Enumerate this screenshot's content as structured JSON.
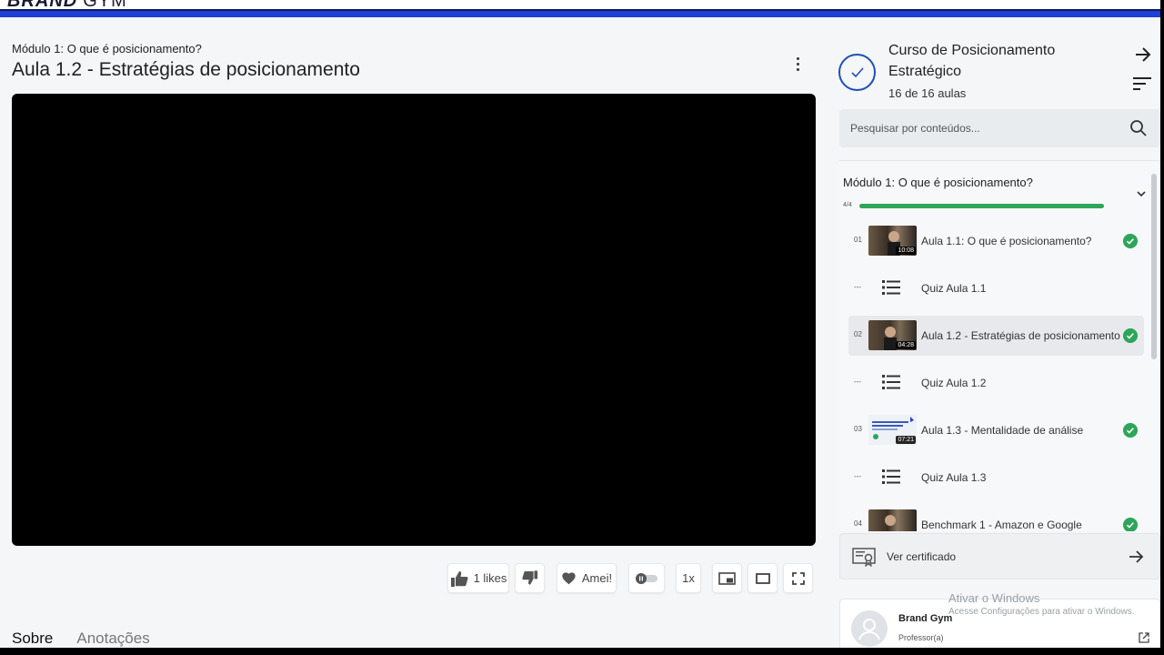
{
  "brand": {
    "bold": "BRAND",
    "light": "GYM"
  },
  "header": {
    "module_subtitle": "Módulo 1: O que é posicionamento?",
    "lesson_title": "Aula 1.2 - Estratégias de posicionamento"
  },
  "player_controls": {
    "likes_label": "1 likes",
    "love_label": "Amei!",
    "speed_label": "1x"
  },
  "tabs": [
    {
      "label": "Sobre",
      "active": true
    },
    {
      "label": "Anotações",
      "active": false
    }
  ],
  "course": {
    "title": "Curso de Posicionamento Estratégico",
    "count": "16 de 16 aulas"
  },
  "search": {
    "placeholder": "Pesquisar por conteúdos..."
  },
  "module": {
    "title": "Módulo 1: O que é posicionamento?",
    "progress_label": "4/4",
    "progress": 1.0
  },
  "lessons": [
    {
      "num": "01",
      "type": "video",
      "label": "Aula 1.1: O que é posicionamento?",
      "duration": "10:08",
      "done": true
    },
    {
      "num": "---",
      "type": "quiz",
      "label": "Quiz Aula 1.1",
      "done": false
    },
    {
      "num": "02",
      "type": "video",
      "label": "Aula 1.2 - Estratégias de posicionamento",
      "duration": "04:28",
      "done": true,
      "selected": true
    },
    {
      "num": "---",
      "type": "quiz",
      "label": "Quiz Aula 1.2",
      "done": false
    },
    {
      "num": "03",
      "type": "video",
      "label": "Aula 1.3 - Mentalidade de análise",
      "duration": "07:21",
      "done": true
    },
    {
      "num": "---",
      "type": "quiz",
      "label": "Quiz Aula 1.3",
      "done": false
    },
    {
      "num": "04",
      "type": "video",
      "label": "Benchmark 1 - Amazon e Google",
      "done": true
    }
  ],
  "certificate": {
    "label": "Ver certificado"
  },
  "professor": {
    "name": "Brand Gym",
    "role": "Professor(a)"
  },
  "watermark": {
    "line1": "Ativar o Windows",
    "line2": "Acesse Configurações para ativar o Windows."
  },
  "colors": {
    "accent": "#1d4fb8",
    "success": "#2ea65a",
    "topbar": "#1e3fd8"
  },
  "icons": [
    "kebab-menu-icon",
    "thumbs-up-icon",
    "thumbs-down-icon",
    "heart-icon",
    "toggle-icon",
    "pip-icon",
    "theater-icon",
    "fullscreen-icon",
    "check-icon",
    "arrow-right-icon",
    "filter-icon",
    "search-icon",
    "chevron-down-icon",
    "list-icon",
    "certificate-icon",
    "external-link-icon",
    "avatar-icon"
  ]
}
